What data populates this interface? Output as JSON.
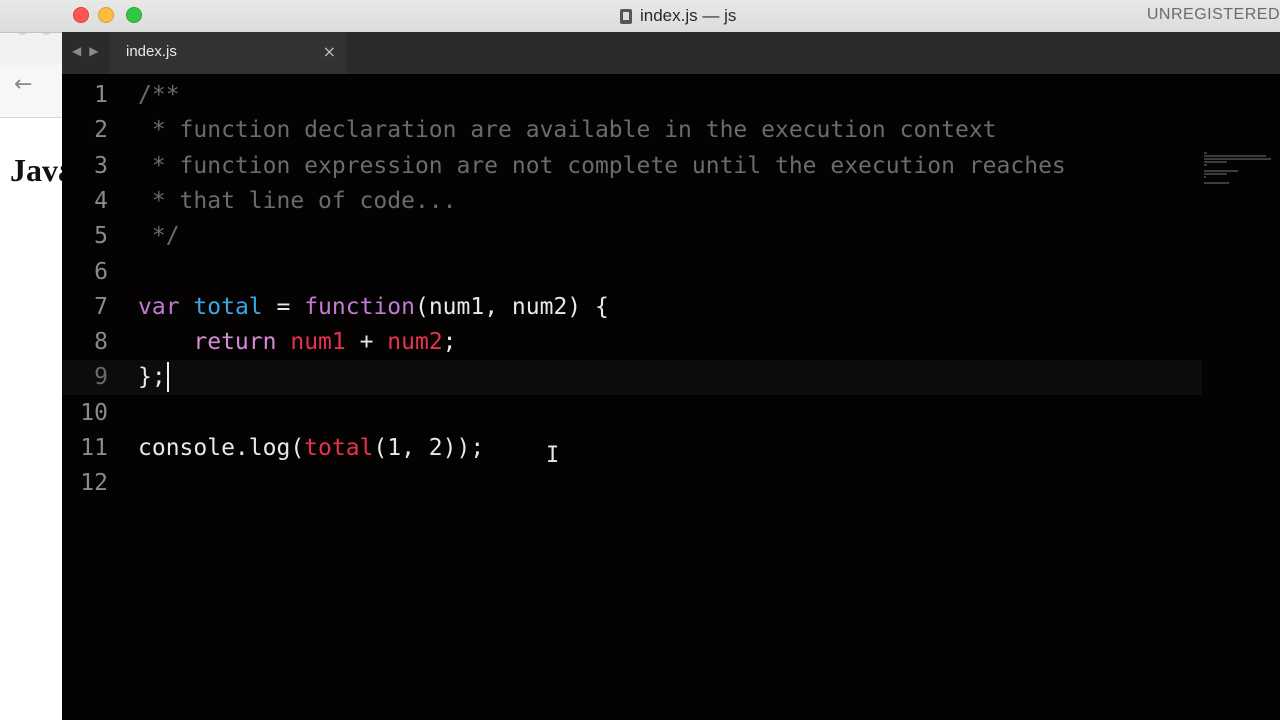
{
  "window": {
    "title": "index.js — js",
    "license_notice": "UNREGISTERED"
  },
  "background_browser": {
    "back_glyph": "←",
    "heading_fragment": "Java"
  },
  "tabs": [
    {
      "label": "index.js",
      "close_glyph": "×",
      "active": true
    }
  ],
  "tab_nav": {
    "prev_glyph": "◀",
    "next_glyph": "▶"
  },
  "editor": {
    "current_line": 9,
    "lines": [
      {
        "n": "1",
        "tokens": [
          {
            "t": "/**",
            "c": "cm"
          }
        ]
      },
      {
        "n": "2",
        "tokens": [
          {
            "t": " * function declaration are available in the execution context",
            "c": "cm"
          }
        ]
      },
      {
        "n": "3",
        "tokens": [
          {
            "t": " * function expression are not complete until the execution reaches",
            "c": "cm"
          }
        ]
      },
      {
        "n": "4",
        "tokens": [
          {
            "t": " * that line of code...",
            "c": "cm"
          }
        ]
      },
      {
        "n": "5",
        "tokens": [
          {
            "t": " */",
            "c": "cm"
          }
        ]
      },
      {
        "n": "6",
        "tokens": []
      },
      {
        "n": "7",
        "tokens": [
          {
            "t": "var",
            "c": "fn"
          },
          {
            "t": " ",
            "c": "plain"
          },
          {
            "t": "total",
            "c": "decl"
          },
          {
            "t": " = ",
            "c": "plain"
          },
          {
            "t": "function",
            "c": "fn"
          },
          {
            "t": "(num1, num2) {",
            "c": "plain"
          }
        ]
      },
      {
        "n": "8",
        "tokens": [
          {
            "t": "    ",
            "c": "plain"
          },
          {
            "t": "return",
            "c": "ret"
          },
          {
            "t": " ",
            "c": "plain"
          },
          {
            "t": "num1",
            "c": "param"
          },
          {
            "t": " + ",
            "c": "plain"
          },
          {
            "t": "num2",
            "c": "param"
          },
          {
            "t": ";",
            "c": "plain"
          }
        ]
      },
      {
        "n": "9",
        "tokens": [
          {
            "t": "};",
            "c": "plain"
          }
        ]
      },
      {
        "n": "10",
        "tokens": []
      },
      {
        "n": "11",
        "tokens": [
          {
            "t": "console.log(",
            "c": "plain"
          },
          {
            "t": "total",
            "c": "param"
          },
          {
            "t": "(1, 2));",
            "c": "plain"
          }
        ]
      },
      {
        "n": "12",
        "tokens": []
      }
    ]
  },
  "colors": {
    "editor_bg": "#050302",
    "comment": "#6b6b6b",
    "keyword": "#c07bd4",
    "declaration": "#39a6e8",
    "parameter": "#e5324f",
    "plain": "#e8e8e8"
  }
}
